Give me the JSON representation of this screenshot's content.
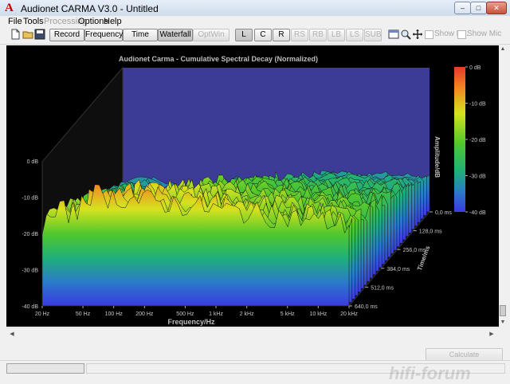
{
  "window": {
    "title": "Audionet CARMA V3.0 - Untitled",
    "logo_text": "A"
  },
  "menu": [
    {
      "label": "File",
      "enabled": true
    },
    {
      "label": "Tools",
      "enabled": true
    },
    {
      "label": "Processing",
      "enabled": false
    },
    {
      "label": "Options",
      "enabled": true
    },
    {
      "label": "Help",
      "enabled": true
    }
  ],
  "toolbar": {
    "view_buttons": [
      {
        "label": "Record",
        "state": "normal"
      },
      {
        "label": "Frequency",
        "state": "normal"
      },
      {
        "label": "Time",
        "state": "normal"
      },
      {
        "label": "Waterfall",
        "state": "active"
      },
      {
        "label": "OptWin",
        "state": "disabled"
      }
    ],
    "channel_buttons": [
      {
        "label": "L",
        "state": "active"
      },
      {
        "label": "C",
        "state": "normal"
      },
      {
        "label": "R",
        "state": "normal"
      },
      {
        "label": "RS",
        "state": "disabled"
      },
      {
        "label": "RB",
        "state": "disabled"
      },
      {
        "label": "LB",
        "state": "disabled"
      },
      {
        "label": "LS",
        "state": "disabled"
      },
      {
        "label": "SUB",
        "state": "disabled"
      }
    ],
    "checkboxes": [
      {
        "label": "Show Eq.",
        "checked": false
      },
      {
        "label": "Show Mic",
        "checked": false
      }
    ]
  },
  "calculate_label": "Calculate",
  "watermark": "hifi-forum",
  "chart_data": {
    "type": "waterfall",
    "title": "Audionet Carma - Cumulative Spectral Decay (Normalized)",
    "xlabel": "Frequency/Hz",
    "ylabel": "Amplitude/dB",
    "zlabel": "Time/ms",
    "x_ticks": [
      "20 Hz",
      "50 Hz",
      "100 Hz",
      "200 Hz",
      "500 Hz",
      "1 kHz",
      "2 kHz",
      "5 kHz",
      "10 kHz",
      "20 kHz"
    ],
    "y_ticks": [
      "0 dB",
      "-10 dB",
      "-20 dB",
      "-30 dB",
      "-40 dB"
    ],
    "z_ticks": [
      "0,0 ms",
      "128,0 ms",
      "256,0 ms",
      "384,0 ms",
      "512,0 ms",
      "640,0 ms"
    ],
    "colorbar_ticks": [
      "0 dB",
      "-10 dB",
      "-20 dB",
      "-30 dB",
      "-40 dB"
    ],
    "x_range_hz": [
      20,
      20000
    ],
    "y_range_db": [
      -40,
      0
    ],
    "time_range_ms": [
      0,
      640
    ],
    "colors": {
      "plot_bg": "#000000",
      "floor": "#3c3c96",
      "text": "#c8c8c8"
    }
  }
}
